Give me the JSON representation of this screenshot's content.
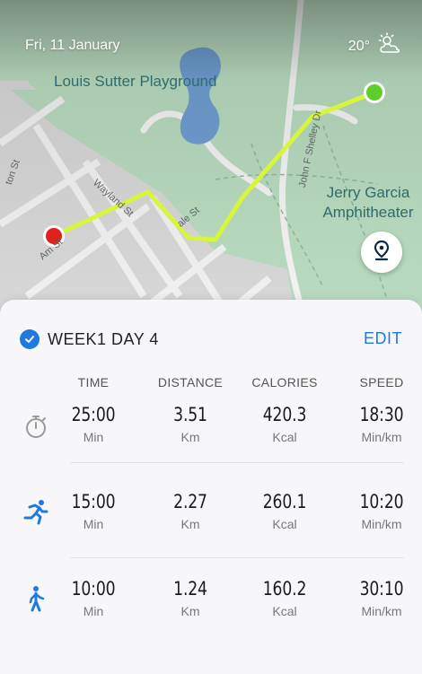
{
  "status": {
    "date": "Fri, 11 January",
    "temperature": "20°",
    "weather_icon": "partly-cloudy-icon"
  },
  "map": {
    "places": [
      "Louis Sutter Playground",
      "Jerry Garcia Amphitheater"
    ],
    "streets": [
      "Wayland St",
      "John F Shelley Dr",
      "ale St",
      "Am St",
      "ton St"
    ],
    "route_color": "#d7f53b",
    "start_color": "#e0201b",
    "end_color": "#5ccf2b",
    "locate_icon": "location-pin-icon"
  },
  "workout": {
    "title": "WEEK1 DAY 4",
    "edit_label": "EDIT",
    "accent": "#1f7ae0"
  },
  "columns": [
    "TIME",
    "DISTANCE",
    "CALORIES",
    "SPEED"
  ],
  "rows": [
    {
      "icon": "stopwatch-icon",
      "time": "25:00",
      "time_unit": "Min",
      "distance": "3.51",
      "distance_unit": "Km",
      "calories": "420.3",
      "calories_unit": "Kcal",
      "speed": "18:30",
      "speed_unit": "Min/km"
    },
    {
      "icon": "running-icon",
      "time": "15:00",
      "time_unit": "Min",
      "distance": "2.27",
      "distance_unit": "Km",
      "calories": "260.1",
      "calories_unit": "Kcal",
      "speed": "10:20",
      "speed_unit": "Min/km"
    },
    {
      "icon": "walking-icon",
      "time": "10:00",
      "time_unit": "Min",
      "distance": "1.24",
      "distance_unit": "Km",
      "calories": "160.2",
      "calories_unit": "Kcal",
      "speed": "30:10",
      "speed_unit": "Min/km"
    }
  ]
}
